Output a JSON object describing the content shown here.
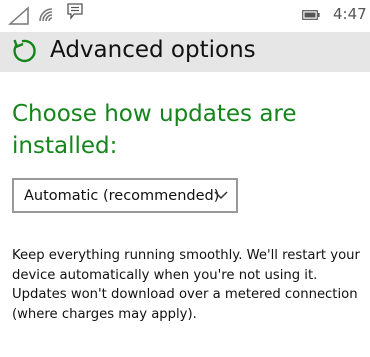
{
  "status_bar": {
    "time": "4:47",
    "icons": [
      "signal-icon",
      "wifi-icon",
      "message-icon",
      "battery-icon"
    ]
  },
  "header": {
    "title": "Advanced options",
    "icon": "update-sync-icon"
  },
  "updates": {
    "heading": "Choose how updates are installed:",
    "selected_option": "Automatic (recommended)",
    "description": "Keep everything running smoothly. We'll restart your device automatically when you're not using it. Updates won't download over a metered connection (where charges may apply)."
  },
  "colors": {
    "accent": "#15851b",
    "header_bg": "#e6e6e6",
    "text": "#111111"
  }
}
